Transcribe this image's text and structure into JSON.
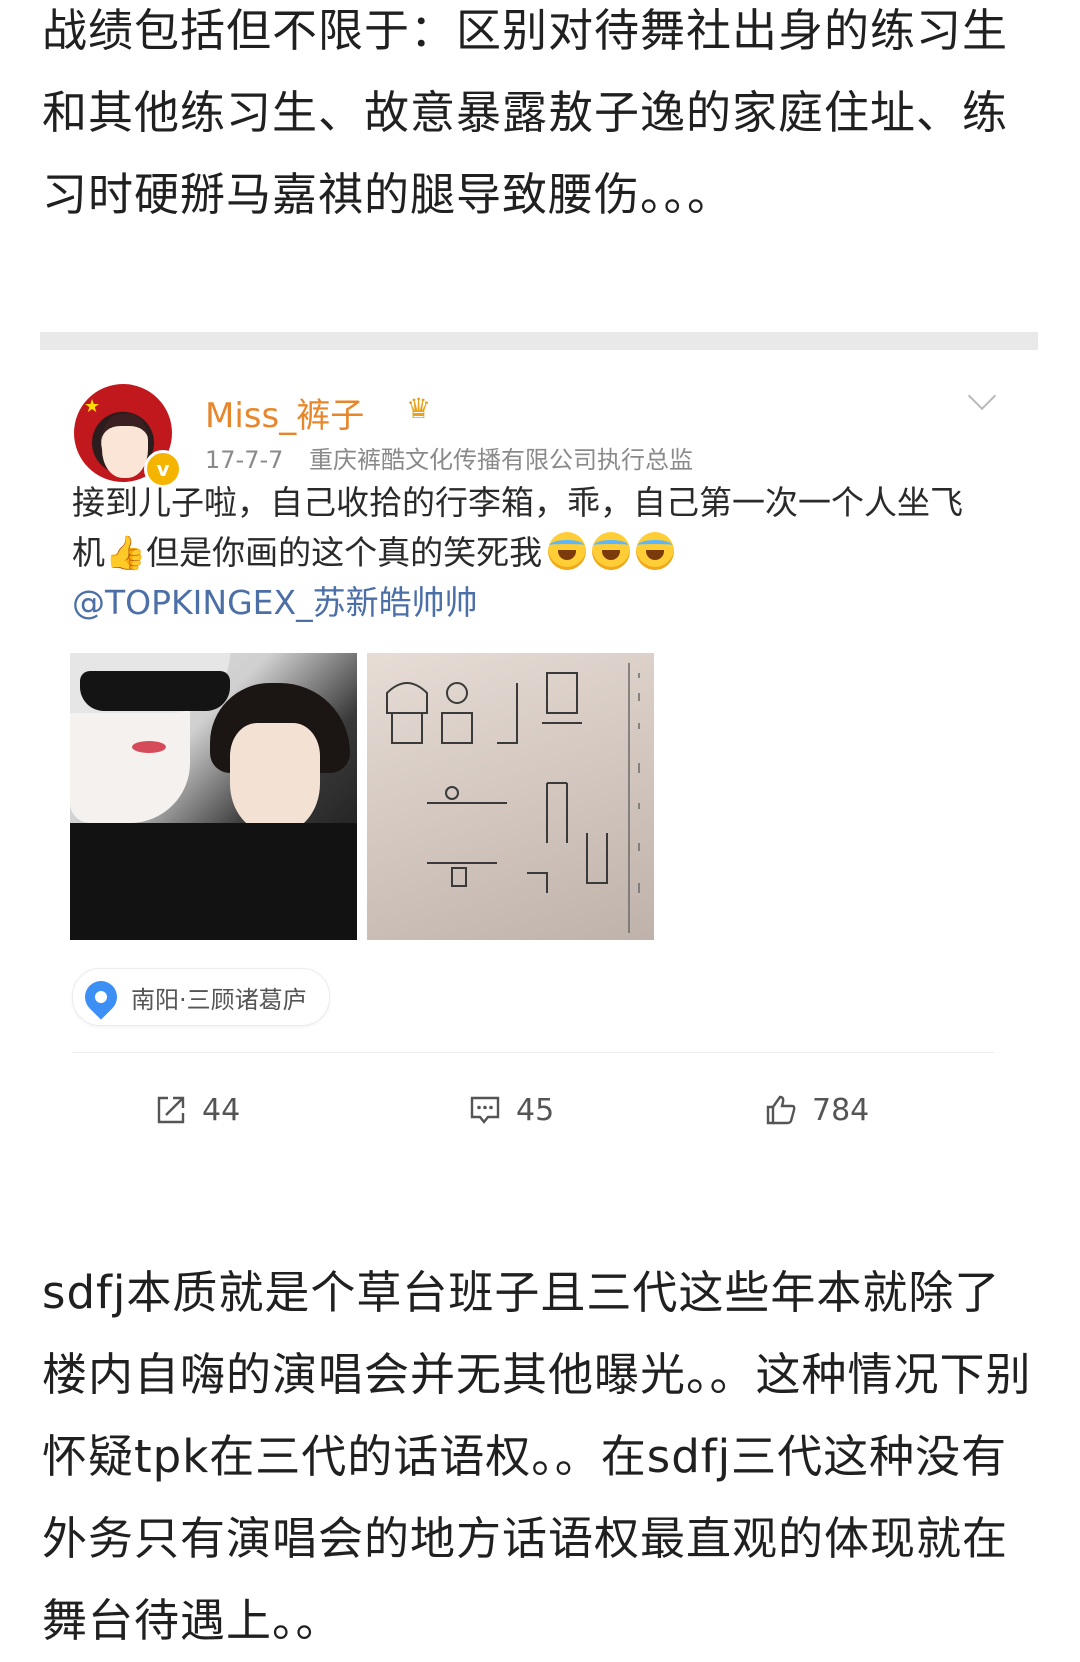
{
  "intro_paragraph": "战绩包括但不限于：区别对待舞社出身的练习生和其他练习生、故意暴露敖子逸的家庭住址、练习时硬掰马嘉祺的腿导致腰伤。。。",
  "post": {
    "username": "Miss_裤子",
    "date": "17-7-7",
    "bio": "重庆裤酷文化传播有限公司执行总监",
    "text_main": "接到儿子啦，自己收拾的行李箱，乖，自己第一次一个人坐飞机",
    "text_after_thumb": "但是你画的这个真的笑死我",
    "mention": "@TOPKINGEX_苏新皓帅帅",
    "location": "南阳·三顾诸葛庐",
    "stats": {
      "reposts": "44",
      "comments": "45",
      "likes": "784"
    }
  },
  "closing_paragraph": "sdfj本质就是个草台班子且三代这些年本就除了楼内自嗨的演唱会并无其他曝光。。这种情况下别怀疑tpk在三代的话语权。。在sdfj三代这种没有外务只有演唱会的地方话语权最直观的体现就在舞台待遇上。。",
  "colors": {
    "username": "#e8862b",
    "mention": "#4c6fa8",
    "location_pin": "#3c8ff5"
  }
}
